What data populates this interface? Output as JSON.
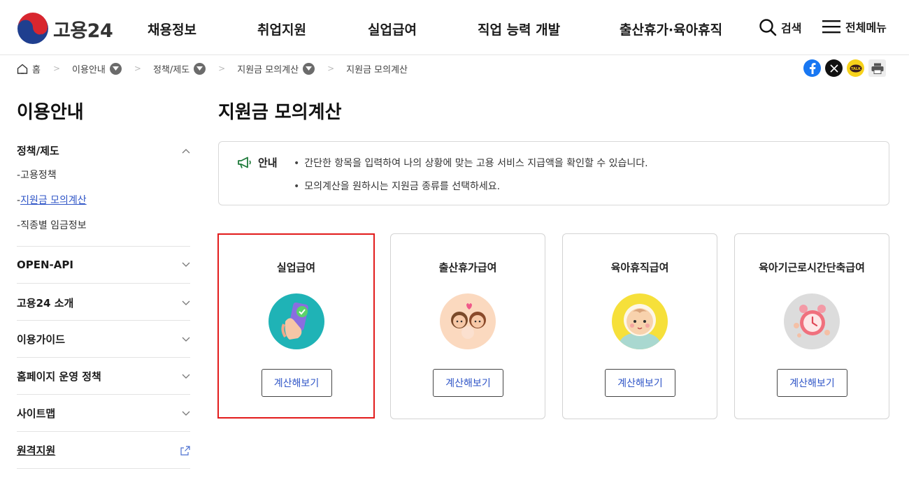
{
  "header": {
    "logo_text": "고용24",
    "nav": [
      "채용정보",
      "취업지원",
      "실업급여",
      "직업 능력 개발",
      "출산휴가·육아휴직"
    ],
    "search_label": "검색",
    "menu_label": "전체메뉴"
  },
  "breadcrumb": [
    "홈",
    "이용안내",
    "정책/제도",
    "지원금 모의계산",
    "지원금 모의계산"
  ],
  "share": {
    "colors": {
      "facebook": "#1877f2",
      "x": "#111111",
      "kakao": "#f7d21b",
      "print": "#e9e9e9"
    }
  },
  "sidebar": {
    "title": "이용안내",
    "groups": [
      {
        "label": "정책/제도",
        "expanded": true,
        "items": [
          "고용정책",
          "지원금 모의계산",
          "직종별 임금정보"
        ]
      },
      {
        "label": "OPEN-API"
      },
      {
        "label": "고용24 소개"
      },
      {
        "label": "이용가이드"
      },
      {
        "label": "홈페이지 운영 정책"
      },
      {
        "label": "사이트맵"
      },
      {
        "label": "원격지원"
      }
    ]
  },
  "main": {
    "title": "지원금 모의계산",
    "notice_label": "안내",
    "notice_lines": [
      "간단한 항목을 입력하여 나의 상황에 맞는 고용 서비스 지급액을 확인할 수 있습니다.",
      "모의계산을 원하시는 지원금 종류를 선택하세요."
    ],
    "cards": [
      {
        "title": "실업급여",
        "button": "계산해보기",
        "icon": "phone-check-icon",
        "selected": true
      },
      {
        "title": "출산휴가급여",
        "button": "계산해보기",
        "icon": "couple-baby-icon"
      },
      {
        "title": "육아휴직급여",
        "button": "계산해보기",
        "icon": "baby-face-icon"
      },
      {
        "title": "육아기근로시간단축급여",
        "button": "계산해보기",
        "icon": "alarm-clock-icon"
      }
    ]
  },
  "colors": {
    "accent": "#2f55c7",
    "selection": "#e21b1b",
    "notice_icon": "#1e7a3a"
  }
}
